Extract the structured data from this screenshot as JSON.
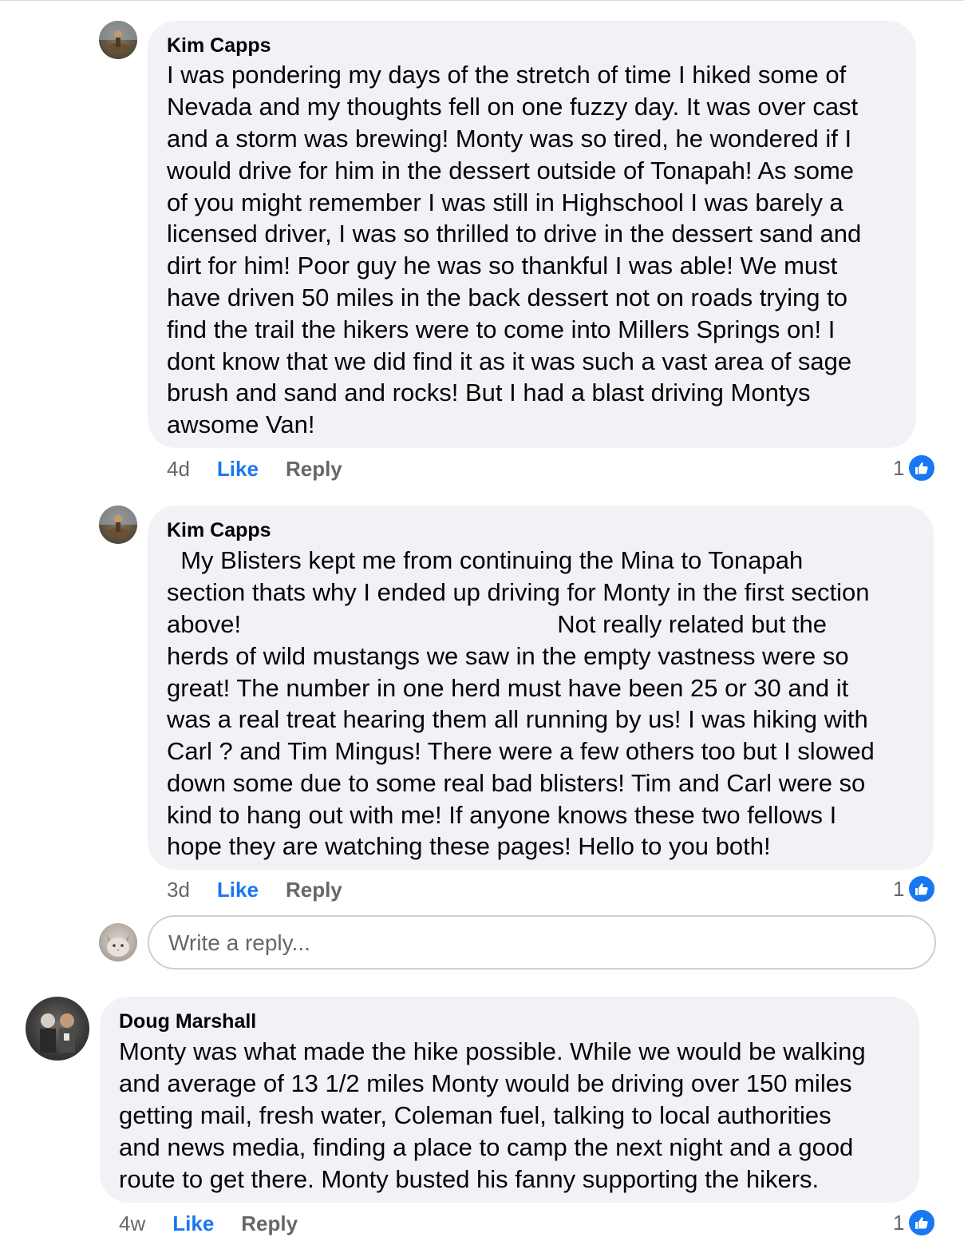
{
  "comments": [
    {
      "author": "Kim Capps",
      "lines": [
        "I was pondering my days of the stretch of time I hiked some of",
        "Nevada and my thoughts fell on one fuzzy day. It was over cast",
        "and a storm was brewing! Monty was so tired, he wondered if I",
        "would drive for him in the dessert outside of Tonapah! As some",
        "of you might remember I was still in Highschool I was barely a",
        "licensed driver, I was so thrilled to drive in the dessert sand and",
        "dirt for him! Poor guy he was so thankful I was able! We must",
        "have driven 50 miles in the back dessert not on roads trying to",
        "find the trail the hikers were to come into Millers Springs on! I",
        "dont know that we did find it as it was such a vast area of sage",
        "brush and sand and rocks! But I had a blast driving Montys",
        "awsome Van!"
      ],
      "age": "4d",
      "like_label": "Like",
      "reply_label": "Reply",
      "reaction_count": "1",
      "reaction_icon": "like-icon"
    },
    {
      "author": "Kim Capps",
      "lines": [
        "  My Blisters kept me from continuing the Mina to Tonapah",
        "section thats why I ended up driving for Monty in the first section",
        "above!                                              Not really related but the",
        "herds of wild mustangs we saw in the empty vastness were so",
        "great! The number in one herd must have been 25 or 30 and it",
        "was a real treat hearing them all running by us! I was hiking with",
        "Carl ? and Tim Mingus! There were a few others too but I slowed",
        "down some due to some real bad blisters! Tim and Carl were so",
        "kind to hang out with me! If anyone knows these two fellows I",
        "hope they are watching these pages! Hello to you both!"
      ],
      "age": "3d",
      "like_label": "Like",
      "reply_label": "Reply",
      "reaction_count": "1",
      "reaction_icon": "like-icon"
    },
    {
      "author": "Doug Marshall",
      "lines": [
        "Monty was what made the hike possible. While we would be walking",
        "and average of 13 1/2 miles Monty would be driving over 150 miles",
        "getting mail, fresh water, Coleman fuel, talking to local authorities",
        "and news media, finding a place to camp the next night and a good",
        "route to get there. Monty busted his fanny supporting the hikers."
      ],
      "age": "4w",
      "like_label": "Like",
      "reply_label": "Reply",
      "reaction_count": "1",
      "reaction_icon": "like-icon"
    }
  ],
  "reply_box": {
    "placeholder": "Write a reply..."
  },
  "colors": {
    "bubble": "#f0f2f5",
    "like_blue": "#1877f2",
    "meta_gray": "#65676b",
    "text": "#050505"
  }
}
